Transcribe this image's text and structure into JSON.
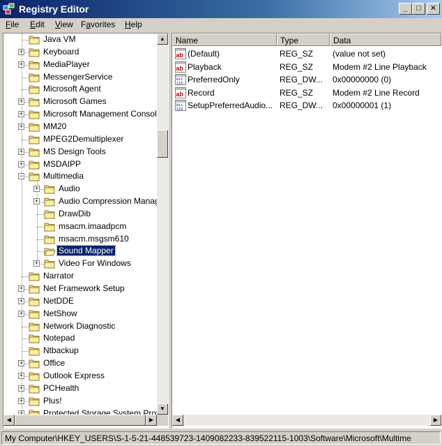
{
  "window": {
    "title": "Registry Editor"
  },
  "menu": [
    {
      "mnemonic": "F",
      "rest": "ile"
    },
    {
      "mnemonic": "E",
      "rest": "dit"
    },
    {
      "mnemonic": "V",
      "rest": "iew"
    },
    {
      "mnemonic": "",
      "rest": "Favorites"
    },
    {
      "mnemonic": "H",
      "rest": "elp"
    }
  ],
  "favorites_label": {
    "before": "F",
    "mnemonic": "a",
    "after": "vorites"
  },
  "tree": {
    "items": [
      {
        "label": "Java VM",
        "level": 1,
        "expander": "none"
      },
      {
        "label": "Keyboard",
        "level": 1,
        "expander": "plus"
      },
      {
        "label": "MediaPlayer",
        "level": 1,
        "expander": "plus"
      },
      {
        "label": "MessengerService",
        "level": 1,
        "expander": "none"
      },
      {
        "label": "Microsoft Agent",
        "level": 1,
        "expander": "none"
      },
      {
        "label": "Microsoft Games",
        "level": 1,
        "expander": "plus"
      },
      {
        "label": "Microsoft Management Console",
        "level": 1,
        "expander": "plus"
      },
      {
        "label": "MM20",
        "level": 1,
        "expander": "plus"
      },
      {
        "label": "MPEG2Demultiplexer",
        "level": 1,
        "expander": "none"
      },
      {
        "label": "MS Design Tools",
        "level": 1,
        "expander": "plus"
      },
      {
        "label": "MSDAIPP",
        "level": 1,
        "expander": "plus"
      },
      {
        "label": "Multimedia",
        "level": 1,
        "expander": "minus"
      },
      {
        "label": "Audio",
        "level": 2,
        "expander": "plus"
      },
      {
        "label": "Audio Compression Manager",
        "level": 2,
        "expander": "plus"
      },
      {
        "label": "DrawDib",
        "level": 2,
        "expander": "none"
      },
      {
        "label": "msacm.imaadpcm",
        "level": 2,
        "expander": "none"
      },
      {
        "label": "msacm.msgsm610",
        "level": 2,
        "expander": "none"
      },
      {
        "label": "Sound Mapper",
        "level": 2,
        "expander": "none",
        "selected": true
      },
      {
        "label": "Video For Windows",
        "level": 2,
        "expander": "plus"
      },
      {
        "label": "Narrator",
        "level": 1,
        "expander": "none"
      },
      {
        "label": "Net Framework Setup",
        "level": 1,
        "expander": "plus"
      },
      {
        "label": "NetDDE",
        "level": 1,
        "expander": "plus"
      },
      {
        "label": "NetShow",
        "level": 1,
        "expander": "plus"
      },
      {
        "label": "Network Diagnostic",
        "level": 1,
        "expander": "none"
      },
      {
        "label": "Notepad",
        "level": 1,
        "expander": "none"
      },
      {
        "label": "Ntbackup",
        "level": 1,
        "expander": "none"
      },
      {
        "label": "Office",
        "level": 1,
        "expander": "plus"
      },
      {
        "label": "Outlook Express",
        "level": 1,
        "expander": "plus"
      },
      {
        "label": "PCHealth",
        "level": 1,
        "expander": "plus"
      },
      {
        "label": "Plus!",
        "level": 1,
        "expander": "plus"
      },
      {
        "label": "Protected Storage System Provider",
        "level": 1,
        "expander": "plus"
      }
    ]
  },
  "values": {
    "columns": [
      "Name",
      "Type",
      "Data"
    ],
    "rows": [
      {
        "name": "(Default)",
        "type": "REG_SZ",
        "data": "(value not set)",
        "icon": "string-value-icon"
      },
      {
        "name": "Playback",
        "type": "REG_SZ",
        "data": "Modem #2 Line Playback",
        "icon": "string-value-icon"
      },
      {
        "name": "PreferredOnly",
        "type": "REG_DW...",
        "data": "0x00000000 (0)",
        "icon": "dword-value-icon"
      },
      {
        "name": "Record",
        "type": "REG_SZ",
        "data": "Modem #2 Line Record",
        "icon": "string-value-icon"
      },
      {
        "name": "SetupPreferredAudio...",
        "type": "REG_DW...",
        "data": "0x00000001 (1)",
        "icon": "dword-value-icon"
      }
    ]
  },
  "status": {
    "path": "My Computer\\HKEY_USERS\\S-1-5-21-448539723-1409082233-839522115-1003\\Software\\Microsoft\\Multime"
  },
  "colors": {
    "title_start": "#0a246a",
    "selection": "#0a246a",
    "folder": "#f5e38c",
    "window": "#d4d0c8"
  }
}
